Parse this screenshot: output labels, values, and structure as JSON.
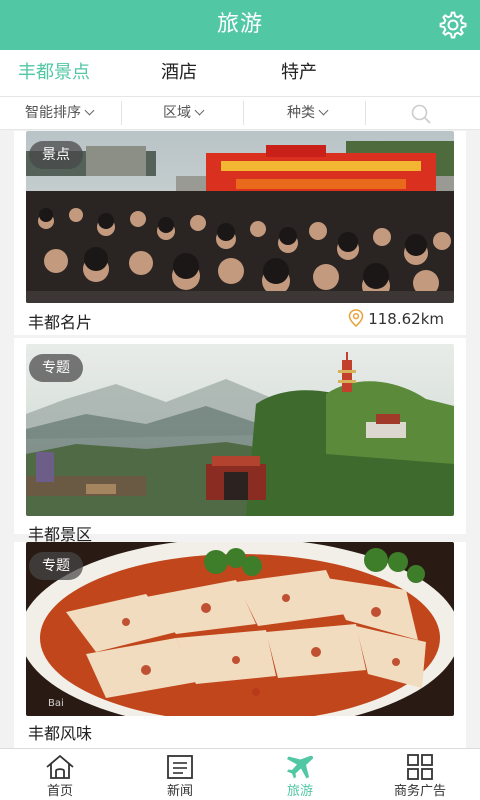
{
  "header": {
    "title": "旅游",
    "settings_icon": "gear-icon"
  },
  "tabs": [
    {
      "label": "丰都景点",
      "active": true
    },
    {
      "label": "酒店",
      "active": false
    },
    {
      "label": "特产",
      "active": false
    }
  ],
  "filters": [
    {
      "label": "智能排序"
    },
    {
      "label": "区域"
    },
    {
      "label": "种类"
    }
  ],
  "cards": [
    {
      "tag": "景点",
      "title": "丰都名片",
      "distance": "118.62km"
    },
    {
      "tag": "专题",
      "title": "丰都景区"
    },
    {
      "tag": "专题",
      "title": "丰都风味"
    }
  ],
  "nav": [
    {
      "label": "首页",
      "icon": "home-icon",
      "active": false
    },
    {
      "label": "新闻",
      "icon": "news-icon",
      "active": false
    },
    {
      "label": "旅游",
      "icon": "airplane-icon",
      "active": true
    },
    {
      "label": "商务广告",
      "icon": "grid-icon",
      "active": false
    }
  ],
  "colors": {
    "accent": "#52c7a4",
    "tag_bg": "#464646"
  }
}
